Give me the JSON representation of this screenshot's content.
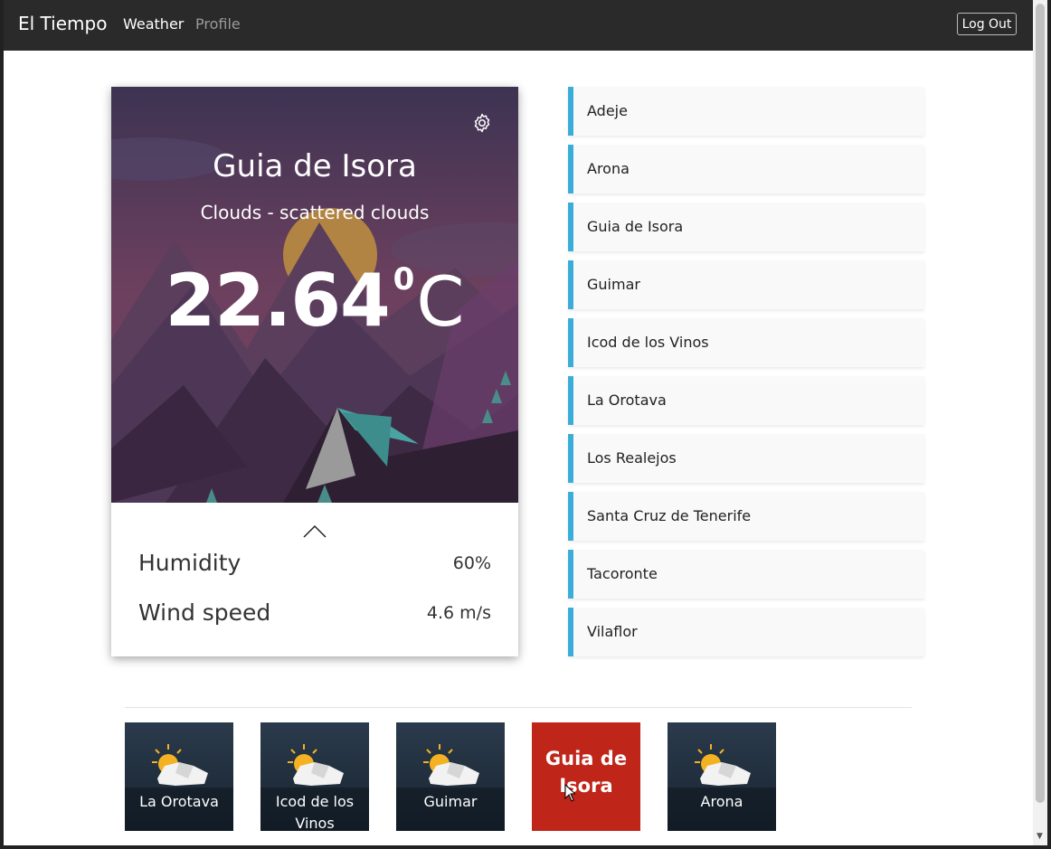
{
  "navbar": {
    "brand": "El Tiempo",
    "links": [
      "Weather",
      "Profile"
    ],
    "logout_label": "Log Out"
  },
  "weather": {
    "city": "Guia de Isora",
    "description": "Clouds - scattered clouds",
    "temperature": "22.64",
    "degree_symbol": "0",
    "unit": "C",
    "details": [
      {
        "label": "Humidity",
        "value": "60%"
      },
      {
        "label": "Wind speed",
        "value": "4.6 m/s"
      }
    ]
  },
  "city_list": [
    "Adeje",
    "Arona",
    "Guia de Isora",
    "Guimar",
    "Icod de los Vinos",
    "La Orotava",
    "Los Realejos",
    "Santa Cruz de Tenerife",
    "Tacoronte",
    "Vilaflor"
  ],
  "favorites": [
    {
      "label": "La Orotava",
      "icon": "partly-cloudy-icon",
      "active": false
    },
    {
      "label": "Icod de los Vinos",
      "icon": "partly-cloudy-icon",
      "active": false
    },
    {
      "label": "Guimar",
      "icon": "partly-cloudy-icon",
      "active": false
    },
    {
      "label": "Guia de Isora",
      "icon": "",
      "active": true
    },
    {
      "label": "Arona",
      "icon": "partly-cloudy-icon",
      "active": false
    }
  ],
  "colors": {
    "navbar": "#2a2a2a",
    "list_accent": "#3aaed8",
    "active_favorite": "#c0251a"
  }
}
